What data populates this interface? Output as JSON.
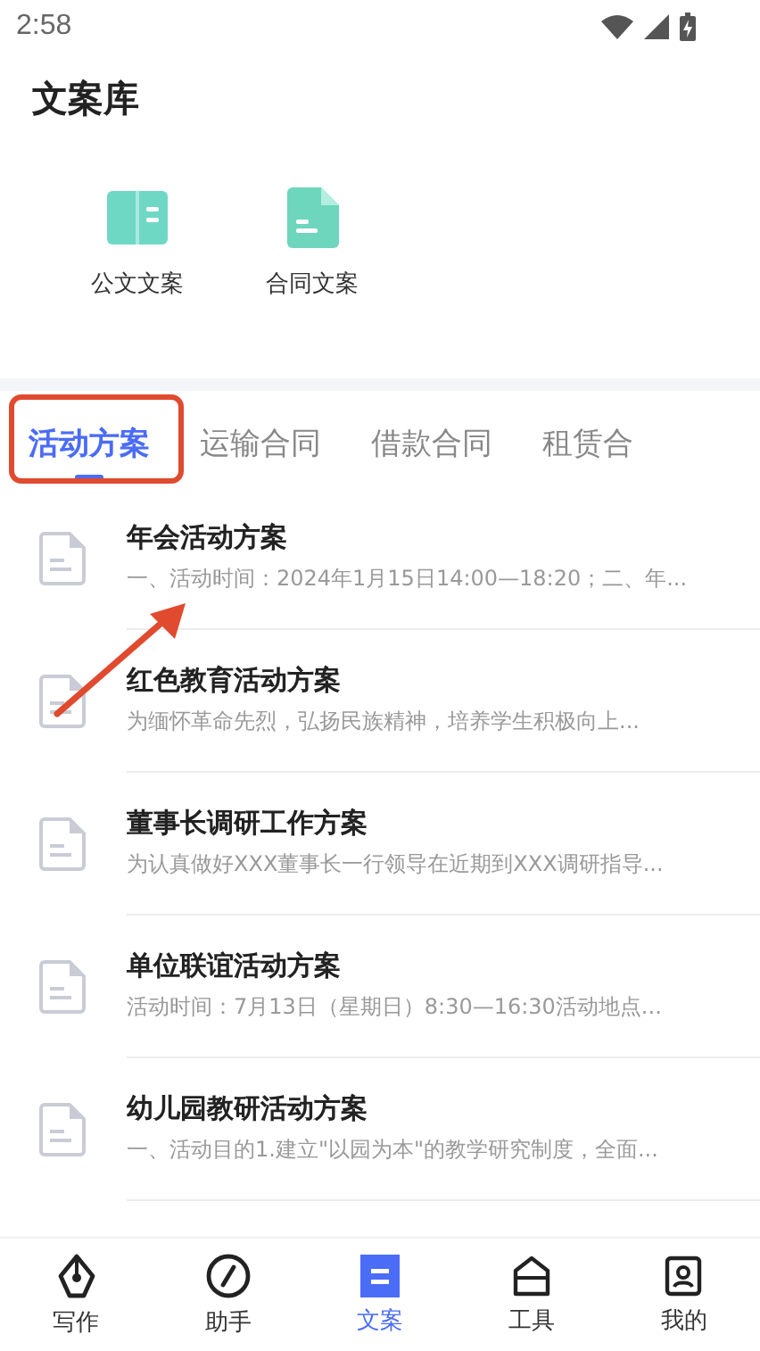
{
  "status_bar": {
    "time": "2:58"
  },
  "page_title": "文案库",
  "categories": [
    {
      "label": "公文文案",
      "kind": "book"
    },
    {
      "label": "合同文案",
      "kind": "doc"
    }
  ],
  "tabs": [
    {
      "label": "活动方案",
      "selected": true
    },
    {
      "label": "运输合同",
      "selected": false
    },
    {
      "label": "借款合同",
      "selected": false
    },
    {
      "label": "租赁合",
      "selected": false
    }
  ],
  "documents": [
    {
      "title": "年会活动方案",
      "excerpt": "一、活动时间：2024年1月15日14:00—18:20；二、年..."
    },
    {
      "title": "红色教育活动方案",
      "excerpt": "为缅怀革命先烈，弘扬民族精神，培养学生积极向上..."
    },
    {
      "title": "董事长调研工作方案",
      "excerpt": "为认真做好XXX董事长一行领导在近期到XXX调研指导..."
    },
    {
      "title": "单位联谊活动方案",
      "excerpt": "活动时间：7月13日（星期日）8:30—16:30活动地点..."
    },
    {
      "title": "幼儿园教研活动方案",
      "excerpt": "一、活动目的1.建立\"以园为本\"的教学研究制度，全面..."
    }
  ],
  "bottom_nav": [
    {
      "label": "写作",
      "kind": "pen",
      "selected": false
    },
    {
      "label": "助手",
      "kind": "compass",
      "selected": false
    },
    {
      "label": "文案",
      "kind": "list",
      "selected": true
    },
    {
      "label": "工具",
      "kind": "tools",
      "selected": false
    },
    {
      "label": "我的",
      "kind": "user",
      "selected": false
    }
  ]
}
